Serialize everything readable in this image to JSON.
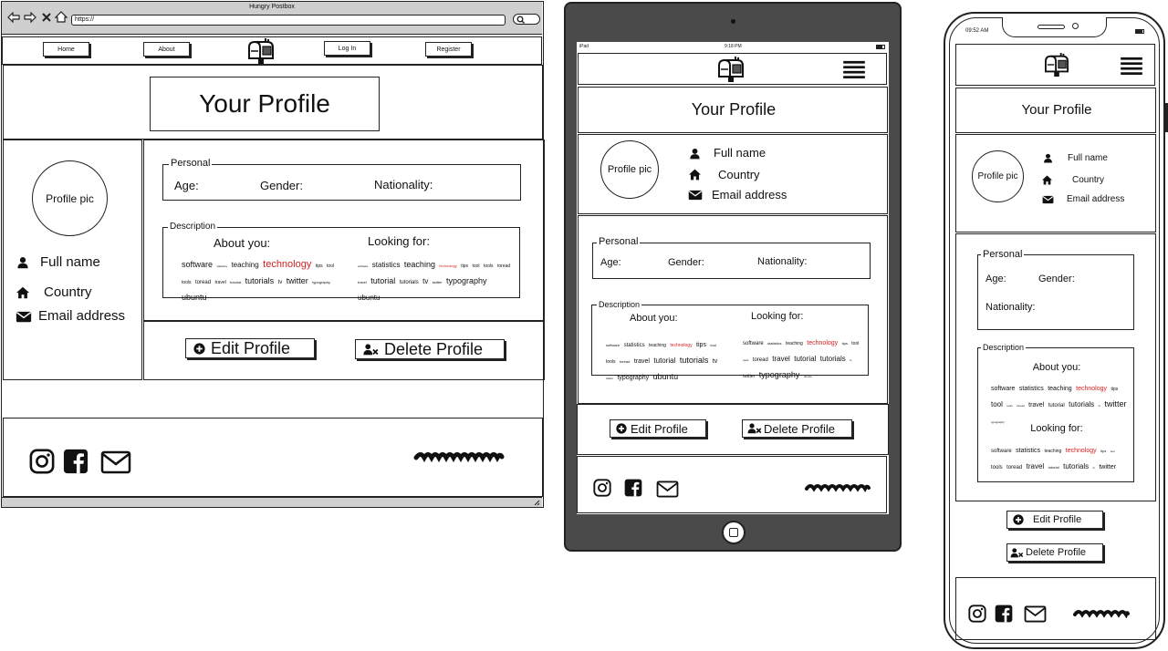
{
  "desktop": {
    "window_title": "Hungry Postbox",
    "address": "https://",
    "nav": [
      "Home",
      "About",
      "Log In",
      "Register"
    ],
    "page_title": "Your Profile",
    "profile_pic": "Profile pic",
    "full_name": "Full name",
    "country": "Country",
    "email": "Email address",
    "personal_legend": "Personal",
    "age": "Age:",
    "gender": "Gender:",
    "nationality": "Nationality:",
    "description_legend": "Description",
    "about_you": "About you:",
    "looking_for": "Looking for:",
    "edit_profile": "Edit Profile",
    "delete_profile": "Delete Profile"
  },
  "tablet": {
    "status_left": "iPad",
    "status_time": "9:18 PM",
    "page_title": "Your Profile",
    "profile_pic": "Profile pic",
    "full_name": "Full name",
    "country": "Country",
    "email": "Email address",
    "personal_legend": "Personal",
    "age": "Age:",
    "gender": "Gender:",
    "nationality": "Nationality:",
    "description_legend": "Description",
    "about_you": "About you:",
    "looking_for": "Looking for:",
    "edit_profile": "Edit Profile",
    "delete_profile": "Delete Profile"
  },
  "phone": {
    "status_time": "09:52 AM",
    "page_title": "Your Profile",
    "profile_pic": "Profile pic",
    "full_name": "Full name",
    "country": "Country",
    "email": "Email address",
    "personal_legend": "Personal",
    "age": "Age:",
    "gender": "Gender:",
    "nationality": "Nationality:",
    "description_legend": "Description",
    "about_you": "About you:",
    "looking_for": "Looking for:",
    "edit_profile": "Edit Profile",
    "delete_profile": "Delete Profile"
  },
  "tag_clouds": {
    "desktop_about": [
      {
        "t": "software",
        "s": 9
      },
      {
        "t": "statistics",
        "s": 3
      },
      {
        "t": "teaching",
        "s": 8
      },
      {
        "t": "technology",
        "s": 11,
        "red": true
      },
      {
        "t": "tips",
        "s": 5
      },
      {
        "t": "tool",
        "s": 5
      },
      {
        "t": "tools",
        "s": 5
      },
      {
        "t": "toread",
        "s": 6
      },
      {
        "t": "travel",
        "s": 5
      },
      {
        "t": "tutorial",
        "s": 4
      },
      {
        "t": "tutorials",
        "s": 9
      },
      {
        "t": "tv",
        "s": 6
      },
      {
        "t": "twitter",
        "s": 9
      },
      {
        "t": "typography",
        "s": 4
      },
      {
        "t": "ubuntu",
        "s": 9
      }
    ],
    "desktop_looking": [
      {
        "t": "software",
        "s": 3
      },
      {
        "t": "statistics",
        "s": 8
      },
      {
        "t": "teaching",
        "s": 9
      },
      {
        "t": "technology",
        "s": 4,
        "red": true
      },
      {
        "t": "tips",
        "s": 5
      },
      {
        "t": "tool",
        "s": 5
      },
      {
        "t": "tools",
        "s": 5
      },
      {
        "t": "toread",
        "s": 5
      },
      {
        "t": "travel",
        "s": 4
      },
      {
        "t": "tutorial",
        "s": 9
      },
      {
        "t": "tutorials",
        "s": 6
      },
      {
        "t": "tv",
        "s": 8
      },
      {
        "t": "twitter",
        "s": 4
      },
      {
        "t": "typography",
        "s": 9
      },
      {
        "t": "ubuntu",
        "s": 8
      }
    ],
    "tablet_about": [
      {
        "t": "software",
        "s": 4
      },
      {
        "t": "statistics",
        "s": 6
      },
      {
        "t": "teaching",
        "s": 5
      },
      {
        "t": "technology",
        "s": 5,
        "red": true
      },
      {
        "t": "tips",
        "s": 7
      },
      {
        "t": "tool",
        "s": 4
      },
      {
        "t": "tools",
        "s": 5
      },
      {
        "t": "toread",
        "s": 4
      },
      {
        "t": "travel",
        "s": 7
      },
      {
        "t": "tutorial",
        "s": 8
      },
      {
        "t": "tutorials",
        "s": 9
      },
      {
        "t": "tv",
        "s": 7
      },
      {
        "t": "twitter",
        "s": 3
      },
      {
        "t": "typography",
        "s": 7
      },
      {
        "t": "ubuntu",
        "s": 9
      }
    ],
    "tablet_looking": [
      {
        "t": "software",
        "s": 6
      },
      {
        "t": "statistics",
        "s": 4
      },
      {
        "t": "teaching",
        "s": 5
      },
      {
        "t": "technology",
        "s": 7,
        "red": true
      },
      {
        "t": "tips",
        "s": 4
      },
      {
        "t": "tool",
        "s": 5
      },
      {
        "t": "tools",
        "s": 3
      },
      {
        "t": "toread",
        "s": 6
      },
      {
        "t": "travel",
        "s": 8
      },
      {
        "t": "tutorial",
        "s": 8
      },
      {
        "t": "tutorials",
        "s": 8
      },
      {
        "t": "tv",
        "s": 3
      },
      {
        "t": "twitter",
        "s": 5
      },
      {
        "t": "typography",
        "s": 9
      },
      {
        "t": "ubuntu",
        "s": 3
      }
    ],
    "phone_about": [
      {
        "t": "software",
        "s": 7
      },
      {
        "t": "statistics",
        "s": 7
      },
      {
        "t": "teaching",
        "s": 7
      },
      {
        "t": "technology",
        "s": 7,
        "red": true
      },
      {
        "t": "tips",
        "s": 5
      },
      {
        "t": "tool",
        "s": 8
      },
      {
        "t": "tools",
        "s": 3
      },
      {
        "t": "toread",
        "s": 3
      },
      {
        "t": "travel",
        "s": 7
      },
      {
        "t": "tutorial",
        "s": 6
      },
      {
        "t": "tutorials",
        "s": 8
      },
      {
        "t": "tv",
        "s": 3
      },
      {
        "t": "twitter",
        "s": 9
      },
      {
        "t": "typography",
        "s": 3
      }
    ],
    "phone_looking": [
      {
        "t": "software",
        "s": 6
      },
      {
        "t": "statistics",
        "s": 7
      },
      {
        "t": "teaching",
        "s": 5
      },
      {
        "t": "technology",
        "s": 7,
        "red": true
      },
      {
        "t": "tips",
        "s": 4
      },
      {
        "t": "tool",
        "s": 3
      },
      {
        "t": "tools",
        "s": 6
      },
      {
        "t": "toread",
        "s": 6
      },
      {
        "t": "travel",
        "s": 8
      },
      {
        "t": "tutorial",
        "s": 4
      },
      {
        "t": "tutorials",
        "s": 8
      },
      {
        "t": "tv",
        "s": 3
      },
      {
        "t": "twitter",
        "s": 7
      }
    ]
  },
  "colors": {
    "ink": "#222222",
    "accent_red": "#d41f1f",
    "device_frame": "#4a4a4a",
    "chrome_gray": "#cfcfcf"
  },
  "icons": [
    "user-icon",
    "home-icon",
    "envelope-icon",
    "instagram-icon",
    "facebook-icon",
    "mailbox-logo-icon",
    "hamburger-menu-icon",
    "plus-circle-icon",
    "user-remove-icon"
  ]
}
